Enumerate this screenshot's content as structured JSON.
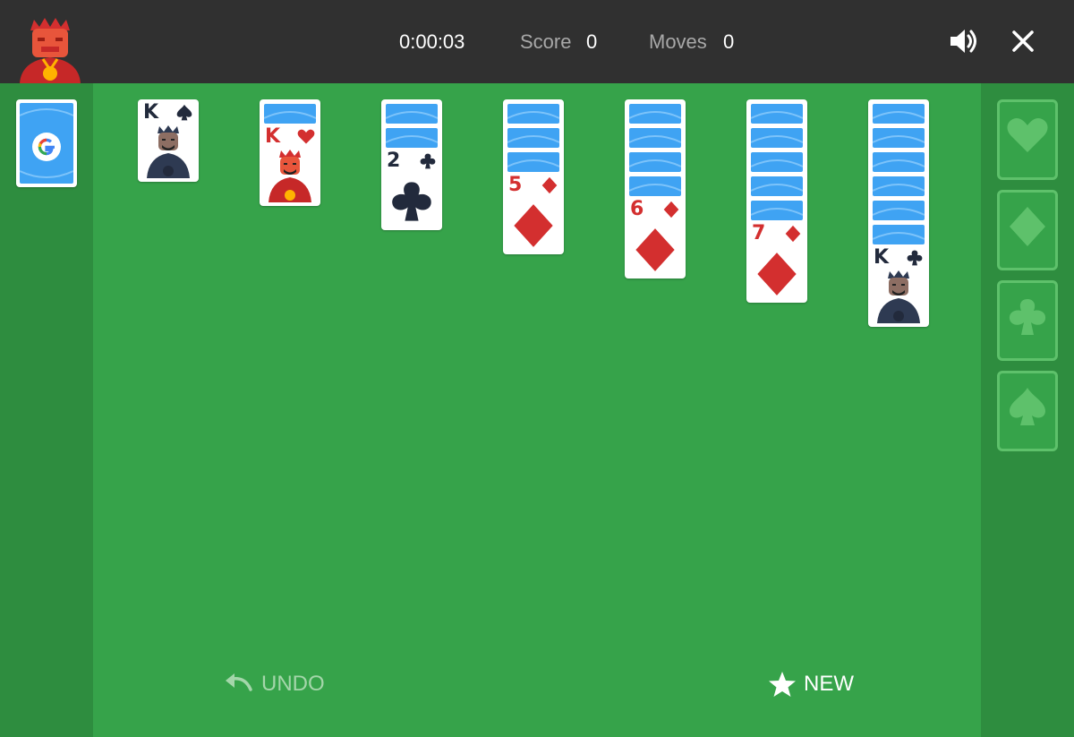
{
  "header": {
    "timer": "0:00:03",
    "score_label": "Score",
    "score_value": "0",
    "moves_label": "Moves",
    "moves_value": "0"
  },
  "stock": {
    "logo_letter": "G"
  },
  "tableau": [
    {
      "face_down": 0,
      "top": {
        "rank": "K",
        "suit": "spades",
        "color": "black"
      }
    },
    {
      "face_down": 1,
      "top": {
        "rank": "K",
        "suit": "hearts",
        "color": "red"
      }
    },
    {
      "face_down": 2,
      "top": {
        "rank": "2",
        "suit": "clubs",
        "color": "black"
      }
    },
    {
      "face_down": 3,
      "top": {
        "rank": "5",
        "suit": "diamonds",
        "color": "red"
      }
    },
    {
      "face_down": 4,
      "top": {
        "rank": "6",
        "suit": "diamonds",
        "color": "red"
      }
    },
    {
      "face_down": 5,
      "top": {
        "rank": "7",
        "suit": "diamonds",
        "color": "red"
      }
    },
    {
      "face_down": 6,
      "top": {
        "rank": "K",
        "suit": "clubs",
        "color": "black"
      }
    }
  ],
  "foundations": [
    "hearts",
    "diamonds",
    "clubs",
    "spades"
  ],
  "controls": {
    "undo_label": "UNDO",
    "new_label": "NEW"
  },
  "colors": {
    "felt": "#36a34a",
    "side_panel": "#2e8d3f",
    "topbar": "#303030",
    "card_back": "#3fa3f3",
    "red_suit": "#d32f2f",
    "black_suit": "#222a3c"
  },
  "icons": [
    "king-mascot-icon",
    "sound-icon",
    "close-icon",
    "google-g-icon",
    "undo-icon",
    "star-icon"
  ]
}
